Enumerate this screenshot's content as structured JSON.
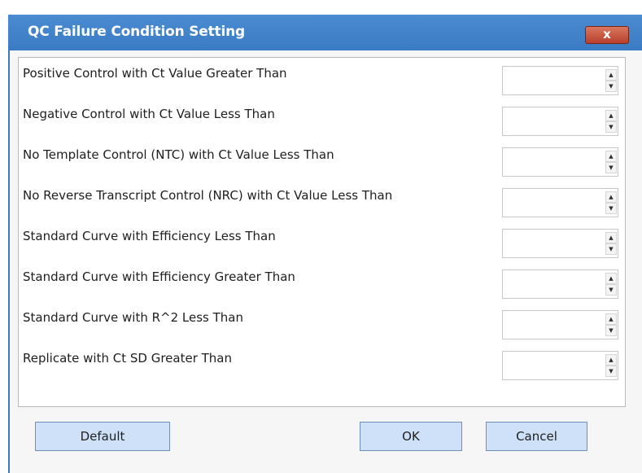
{
  "window": {
    "title": "QC Failure Condition Setting",
    "close_label": "x"
  },
  "conditions": [
    {
      "label": "Positive Control with Ct Value Greater Than",
      "value": ""
    },
    {
      "label": "Negative Control with Ct Value Less Than",
      "value": ""
    },
    {
      "label": "No Template Control (NTC) with Ct Value Less Than",
      "value": ""
    },
    {
      "label": "No Reverse Transcript Control (NRC) with Ct Value Less Than",
      "value": ""
    },
    {
      "label": "Standard Curve with Efficiency Less Than",
      "value": ""
    },
    {
      "label": "Standard Curve with Efficiency Greater Than",
      "value": ""
    },
    {
      "label": "Standard Curve with R^2 Less Than",
      "value": ""
    },
    {
      "label": "Replicate with Ct SD Greater Than",
      "value": ""
    }
  ],
  "spinner_icons": {
    "up": "triangle-up-icon",
    "down": "triangle-down-icon"
  },
  "buttons": {
    "default_label": "Default",
    "ok_label": "OK",
    "cancel_label": "Cancel"
  },
  "colors": {
    "titlebar": "#3d7ec6",
    "close_button": "#c0503a",
    "button_face": "#cfe1f8"
  }
}
